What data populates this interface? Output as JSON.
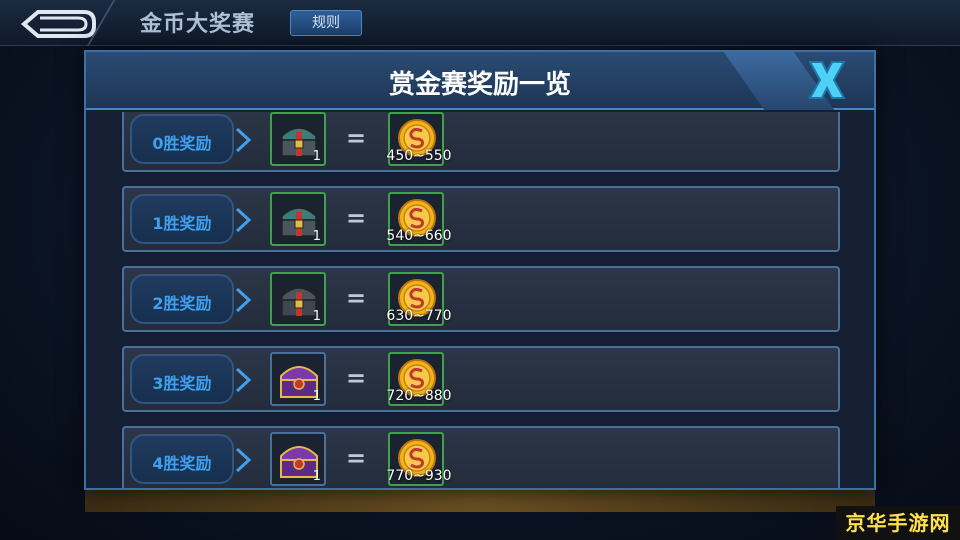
{
  "topbar": {
    "title": "金币大奖赛",
    "rules_label": "规则"
  },
  "modal": {
    "title": "赏金赛奖励一览",
    "rows": [
      {
        "label": "0胜奖励",
        "chest_type": "green",
        "chest_count": "1",
        "coin_range": "450~550"
      },
      {
        "label": "1胜奖励",
        "chest_type": "green",
        "chest_count": "1",
        "coin_range": "540~660"
      },
      {
        "label": "2胜奖励",
        "chest_type": "green",
        "chest_count": "1",
        "coin_range": "630~770"
      },
      {
        "label": "3胜奖励",
        "chest_type": "purple",
        "chest_count": "1",
        "coin_range": "720~880"
      },
      {
        "label": "4胜奖励",
        "chest_type": "purple",
        "chest_count": "1",
        "coin_range": "770~930"
      }
    ],
    "equals_sign": "="
  },
  "watermark": "京华手游网",
  "icons": {
    "back": "back-arrow-icon",
    "close": "close-x-icon",
    "chest_green": "treasure-chest-green-icon",
    "chest_purple": "treasure-chest-purple-icon",
    "coin": "gold-coin-icon",
    "arrow": "chevron-right-icon"
  },
  "colors": {
    "accent_blue": "#3fa1ee",
    "frame_green": "#3fa24a",
    "close_cyan": "#4fd0f5",
    "coin_gold": "#f5b21b"
  }
}
